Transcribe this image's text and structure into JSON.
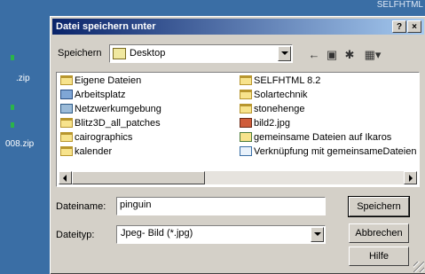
{
  "desktop": {
    "top_right_text": "SELFHTML",
    "left_labels": [
      ".zip",
      "008.zip"
    ]
  },
  "dialog": {
    "title": "Datei speichern unter",
    "help_button": "?",
    "close_button": "×",
    "save_in_label": "Speichern",
    "location": "Desktop",
    "toolbar_icons": [
      "back-icon",
      "up-folder-icon",
      "new-folder-icon",
      "view-menu-icon"
    ],
    "files": [
      {
        "name": "Eigene Dateien",
        "icon": "folder"
      },
      {
        "name": "Arbeitsplatz",
        "icon": "computer"
      },
      {
        "name": "Netzwerkumgebung",
        "icon": "network"
      },
      {
        "name": "Blitz3D_all_patches",
        "icon": "folder"
      },
      {
        "name": "cairographics",
        "icon": "folder"
      },
      {
        "name": "kalender",
        "icon": "folder"
      },
      {
        "name": "SELFHTML 8.2",
        "icon": "folder"
      },
      {
        "name": "Solartechnik",
        "icon": "folder"
      },
      {
        "name": "stonehenge",
        "icon": "folder"
      },
      {
        "name": "bild2.jpg",
        "icon": "image"
      },
      {
        "name": "gemeinsame Dateien auf Ikaros",
        "icon": "share"
      },
      {
        "name": "Verknüpfung mit gemeinsameDateien",
        "icon": "link"
      }
    ],
    "filename_label": "Dateiname:",
    "filename_value": "pinguin",
    "filetype_label": "Dateityp:",
    "filetype_value": "Jpeg- Bild (*.jpg)",
    "save_button": "Speichern",
    "cancel_button": "Abbrechen",
    "help_action_button": "Hilfe"
  }
}
